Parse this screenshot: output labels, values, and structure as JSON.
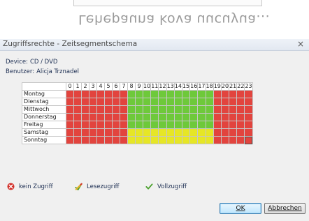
{
  "background": {
    "mirrored_text": "Lehepauna kova uucuyua..."
  },
  "window": {
    "title": "Zugriffsrechte - Zeitsegmentschema",
    "close_glyph": "×"
  },
  "info": {
    "device_label": "Device:",
    "device_value": "CD / DVD",
    "user_label": "Benutzer:",
    "user_value": "Alicja Trznadel"
  },
  "schedule": {
    "hours": [
      "0",
      "1",
      "2",
      "3",
      "4",
      "5",
      "6",
      "7",
      "8",
      "9",
      "10",
      "11",
      "12",
      "13",
      "14",
      "15",
      "16",
      "17",
      "18",
      "19",
      "20",
      "21",
      "22",
      "23"
    ],
    "days": [
      {
        "name": "Montag",
        "access": "none,none,none,none,none,none,none,none,full,full,full,full,full,full,full,full,full,full,full,none,none,none,none,none"
      },
      {
        "name": "Dienstag",
        "access": "none,none,none,none,none,none,none,none,full,full,full,full,full,full,full,full,full,full,full,none,none,none,none,none"
      },
      {
        "name": "Mittwoch",
        "access": "none,none,none,none,none,none,none,none,full,full,full,full,full,full,full,full,full,full,full,none,none,none,none,none"
      },
      {
        "name": "Donnerstag",
        "access": "none,none,none,none,none,none,none,none,full,full,full,full,full,full,full,full,full,full,full,none,none,none,none,none"
      },
      {
        "name": "Freitag",
        "access": "none,none,none,none,none,none,none,none,full,full,full,full,full,full,full,full,full,full,full,none,none,none,none,none"
      },
      {
        "name": "Samstag",
        "access": "none,none,none,none,none,none,none,none,read,read,read,read,read,read,read,read,read,read,read,none,none,none,none,none"
      },
      {
        "name": "Sonntag",
        "access": "none,none,none,none,none,none,none,none,read,read,read,read,read,read,read,read,read,read,read,none,none,none,none,none"
      }
    ],
    "selected_cell": {
      "day": "Sonntag",
      "hour": "23"
    },
    "colors": {
      "none": "#e2443e",
      "read": "#e6e626",
      "full": "#6ec93a"
    }
  },
  "legend": {
    "no_access": {
      "label": "kein Zugriff",
      "icon": "no-access-icon"
    },
    "read_access": {
      "label": "Lesezugriff",
      "icon": "read-access-icon"
    },
    "full_access": {
      "label": "Vollzugriff",
      "icon": "checkmark-icon"
    }
  },
  "buttons": {
    "ok_label": "OK",
    "cancel_label": "Abbrechen"
  }
}
